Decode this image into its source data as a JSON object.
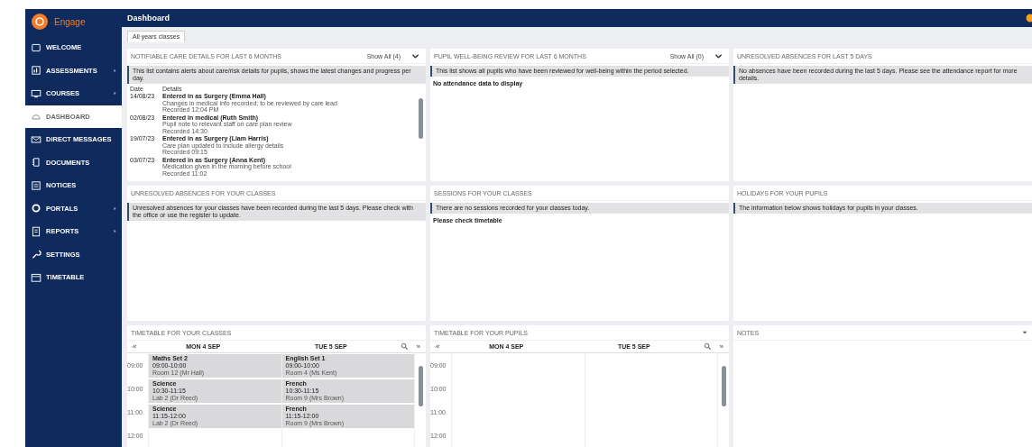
{
  "brand": {
    "name": "Engage"
  },
  "sidebar": {
    "items": [
      {
        "label": "WELCOME",
        "submenu": false,
        "selected": false
      },
      {
        "label": "ASSESSMENTS",
        "submenu": true,
        "selected": false
      },
      {
        "label": "COURSES",
        "submenu": true,
        "selected": false
      },
      {
        "label": "DASHBOARD",
        "submenu": false,
        "selected": true
      },
      {
        "label": "DIRECT MESSAGES",
        "submenu": false,
        "selected": false
      },
      {
        "label": "DOCUMENTS",
        "submenu": false,
        "selected": false
      },
      {
        "label": "NOTICES",
        "submenu": false,
        "selected": false
      },
      {
        "label": "PORTALS",
        "submenu": true,
        "selected": false
      },
      {
        "label": "REPORTS",
        "submenu": true,
        "selected": false
      },
      {
        "label": "SETTINGS",
        "submenu": false,
        "selected": false
      },
      {
        "label": "TIMETABLE",
        "submenu": false,
        "selected": false
      }
    ]
  },
  "header": {
    "title": "Dashboard"
  },
  "filter_tabs": [
    {
      "label": "All years classes",
      "selected": true
    }
  ],
  "panels": [
    {
      "kind": "timeline",
      "title": "NOTIFIABLE CARE DETAILS FOR LAST 6 MONTHS",
      "dropdown": "Show All (4)",
      "info": "This list contains alerts about care/risk details for pupils, shows the latest changes and progress per day.",
      "columns": [
        "Date",
        "Details"
      ],
      "rows": [
        {
          "date": "14/08/23",
          "title": "Entered in as Surgery (Emma Hall)",
          "detail": "Changes in medical info recorded; to be reviewed by care lead",
          "meta": "Recorded 12:04 PM"
        },
        {
          "date": "02/08/23",
          "title": "Entered in medical (Ruth Smith)",
          "detail": "Pupil note to relevant staff on care plan review",
          "meta": "Recorded 14:30"
        },
        {
          "date": "19/07/23",
          "title": "Entered in as Surgery (Liam Harris)",
          "detail": "Care plan updated to include allergy details",
          "meta": "Recorded 09:15"
        },
        {
          "date": "03/07/23",
          "title": "Entered in as Surgery (Anna Kent)",
          "detail": "Medication given in the morning before school",
          "meta": "Recorded 11:02"
        }
      ]
    },
    {
      "kind": "info",
      "title": "PUPIL WELL-BEING REVIEW FOR LAST 6 MONTHS",
      "dropdown": "Show All (0)",
      "info": "This list shows all pupils who have been reviewed for well-being within the period selected.",
      "message": "No attendance data to display"
    },
    {
      "kind": "info",
      "title": "UNRESOLVED ABSENCES FOR LAST 5 DAYS",
      "info": "No absences have been recorded during the last 5 days. Please see the attendance report for more details."
    },
    {
      "kind": "info",
      "title": "UNRESOLVED ABSENCES FOR YOUR CLASSES",
      "info": "Unresolved absences for your classes have been recorded during the last 5 days. Please check with the office or use the register to update."
    },
    {
      "kind": "info",
      "title": "SESSIONS FOR YOUR CLASSES",
      "info": "There are no sessions recorded for your classes today.",
      "message": "Please check timetable"
    },
    {
      "kind": "info",
      "title": "HOLIDAYS FOR YOUR PUPILS",
      "info": "The information below shows holidays for pupils in your classes."
    },
    {
      "kind": "calendar",
      "title": "TIMETABLE FOR YOUR CLASSES",
      "prev": "«",
      "next": "»",
      "columns": [
        "MON 4 SEP",
        "TUE 5 SEP"
      ],
      "times": [
        "09:00",
        "10:00",
        "11:00",
        "12:00"
      ],
      "events": [
        [
          {
            "name": "Maths Set 2",
            "time": "09:00-10:00",
            "room": "Room 12 (Mr Hall)"
          },
          {
            "name": "English Set 1",
            "time": "09:00-10:00",
            "room": "Room 4 (Ms Kent)"
          }
        ],
        [
          {
            "name": "Science",
            "time": "10:30-11:15",
            "room": "Lab 2 (Dr Reed)"
          },
          {
            "name": "French",
            "time": "10:30-11:15",
            "room": "Room 9 (Mrs Brown)"
          }
        ],
        [
          {
            "name": "Science",
            "time": "11:15-12:00",
            "room": "Lab 2 (Dr Reed)"
          },
          {
            "name": "French",
            "time": "11:15-12:00",
            "room": "Room 9 (Mrs Brown)"
          }
        ]
      ]
    },
    {
      "kind": "calendar",
      "title": "TIMETABLE FOR YOUR PUPILS",
      "prev": "«",
      "next": "»",
      "columns": [
        "MON 4 SEP",
        "TUE 5 SEP"
      ],
      "times": [
        "09:00",
        "10:00",
        "11:00",
        "12:00"
      ]
    },
    {
      "kind": "notes",
      "title": "NOTES"
    }
  ]
}
